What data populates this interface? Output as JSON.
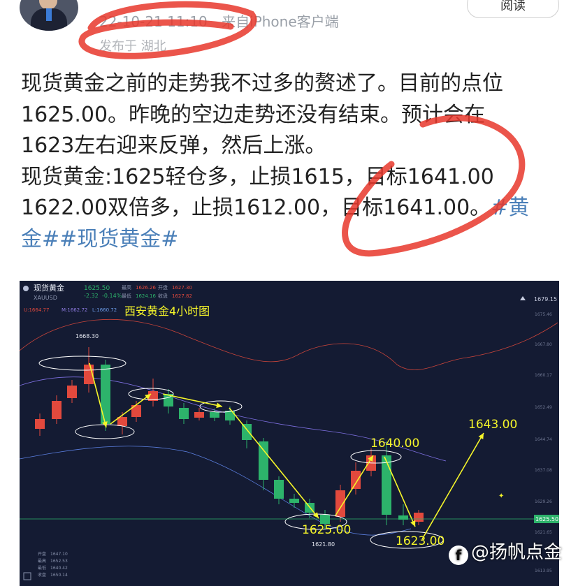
{
  "post": {
    "datetime": "22-10-21 11:10",
    "source": "来自iPhone客户端",
    "location": "发布于 湖北",
    "read_button": "阅读",
    "lines": [
      "现货黄金之前的走势我不过多的赘述了。目前的点位",
      "1625.00。昨晚的空边走势还没有结束。预计会在",
      "1623左右迎来反弹，然后上涨。",
      "现货黄金:1625轻仓多，止损1615，目标1641.00",
      "1622.00双倍多，止损1612.00，目标1641.00。"
    ],
    "hashtag_inline": "#黄",
    "hashtag_line": "金##现货黄金#"
  },
  "chart": {
    "symbol": "现货黄金",
    "code": "XAUUSD",
    "price": "1625.50",
    "change": "-2.32",
    "change_pct": "-0.14%",
    "high_label": "最高",
    "high": "1626.26",
    "low_label": "最低",
    "low": "1624.16",
    "open_label": "开盘",
    "open": "1627.30",
    "close_label": "收盘",
    "close": "1627.82",
    "boll_u": "U:1664.77",
    "boll_m": "M:1662.72",
    "boll_l": "L:1660.72",
    "top_right_value": "1679.15",
    "title": "西安黄金4小时图",
    "peak_label": "1668.30",
    "low_label_bottom": "1621.80",
    "current_tag": "1625.50",
    "axis_ticks": [
      "1675.46",
      "1667.80",
      "1660.17",
      "1652.49",
      "1644.74",
      "1637.08",
      "1629.26",
      "1621.65",
      "1613.95"
    ],
    "bottom_left": [
      {
        "k": "开盘",
        "v": "1647.10"
      },
      {
        "k": "最高",
        "v": "1652.53"
      },
      {
        "k": "最低",
        "v": "1640.42"
      },
      {
        "k": "收盘",
        "v": "1650.14"
      }
    ],
    "annotations": [
      "1625.00",
      "1640.00",
      "1643.00",
      "1623.00"
    ],
    "accent_up": "#e2493d",
    "accent_down": "#2db36b",
    "arrow_color": "#f5f52a"
  },
  "watermark": "@扬帆点金"
}
